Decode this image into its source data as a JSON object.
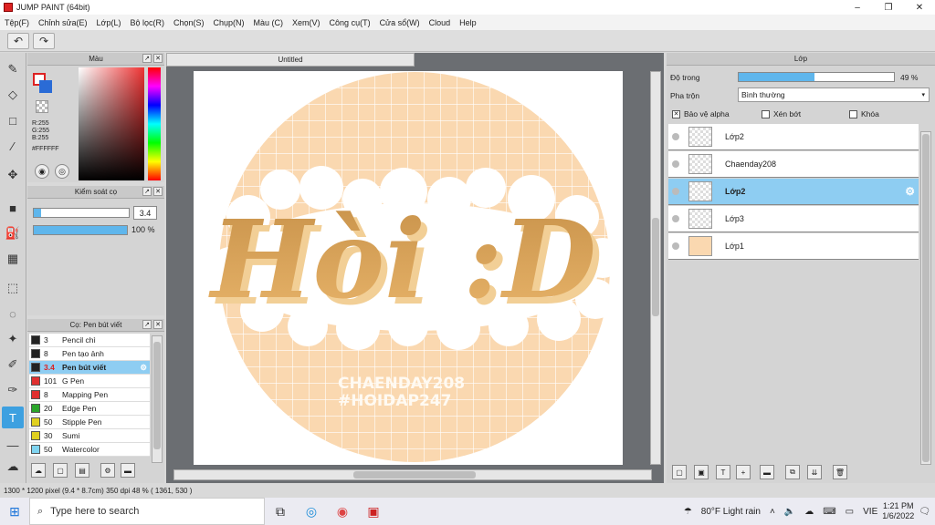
{
  "window": {
    "title": "JUMP PAINT (64bit)",
    "controls": [
      "–",
      "❐",
      "✕"
    ]
  },
  "menu": [
    "Tệp(F)",
    "Chỉnh sửa(E)",
    "Lớp(L)",
    "Bộ lọc(R)",
    "Chọn(S)",
    "Chụp(N)",
    "Màu (C)",
    "Xem(V)",
    "Công cụ(T)",
    "Cửa sổ(W)",
    "Cloud",
    "Help"
  ],
  "color_panel": {
    "title": "Màu",
    "rgb": [
      "R:255",
      "G:255",
      "B:255"
    ],
    "hex": "#FFFFFF"
  },
  "brush_control": {
    "title": "Kiểm soát cọ",
    "size": "3.4",
    "opacity": "100 %",
    "size_fraction": 0.08,
    "opacity_fraction": 1.0
  },
  "pen_panel": {
    "title": "Cọ: Pen bút viết",
    "items": [
      {
        "size": "3",
        "name": "Pencil chì",
        "color": "#222222"
      },
      {
        "size": "8",
        "name": "Pen tạo ảnh",
        "color": "#222222"
      },
      {
        "size": "3.4",
        "name": "Pen bút viết",
        "color": "#222222",
        "selected": true
      },
      {
        "size": "101",
        "name": "G Pen",
        "color": "#e03030"
      },
      {
        "size": "8",
        "name": "Mapping Pen",
        "color": "#e03030"
      },
      {
        "size": "20",
        "name": "Edge Pen",
        "color": "#2aa52a"
      },
      {
        "size": "50",
        "name": "Stipple Pen",
        "color": "#e0d020"
      },
      {
        "size": "30",
        "name": "Sumi",
        "color": "#e0d020"
      },
      {
        "size": "50",
        "name": "Watercolor",
        "color": "#7fd4f0"
      }
    ]
  },
  "document": {
    "tab": "Untitled",
    "artwork_text": "Hòi :D",
    "credit_line1": "CHAENDAY208",
    "credit_line2": "#HOIDAP247"
  },
  "layer_panel": {
    "title": "Lớp",
    "opacity_label": "Độ trong",
    "opacity_value": "49 %",
    "opacity_fraction": 0.49,
    "blend_label": "Pha trộn",
    "blend_value": "Bình thường",
    "checks": [
      "Bảo vệ alpha",
      "Xén bớt",
      "Khóa"
    ],
    "layers": [
      {
        "name": "Lớp2",
        "selected": false
      },
      {
        "name": "Chaenday208",
        "selected": false
      },
      {
        "name": "Lớp2",
        "selected": true
      },
      {
        "name": "Lớp3",
        "selected": false
      },
      {
        "name": "Lớp1",
        "selected": false
      }
    ]
  },
  "status": {
    "text": "1300 * 1200 pixel   (9.4 * 8.7cm)   350 dpi   48 %   ( 1361, 530 )"
  },
  "taskbar": {
    "search_placeholder": "Type here to search",
    "weather": "80°F  Light rain",
    "lang": "VIE",
    "time": "1:21 PM",
    "date": "1/6/2022"
  }
}
